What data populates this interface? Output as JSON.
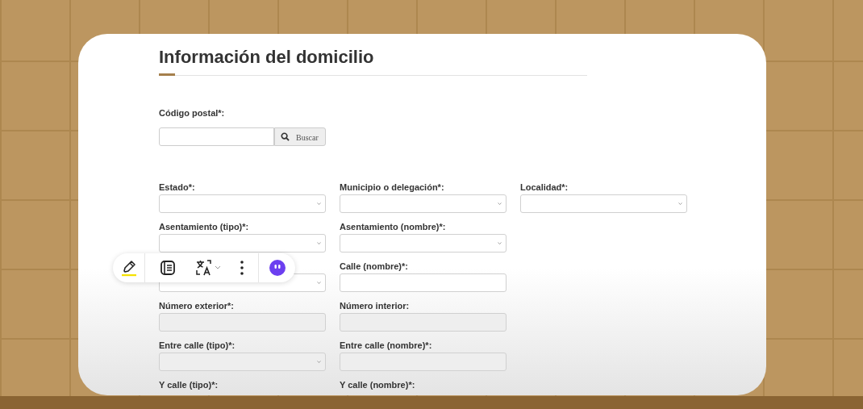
{
  "section_title": "Información del domicilio",
  "postal_code": {
    "label": "Código postal*:",
    "button": "Buscar"
  },
  "rows": [
    {
      "fields": [
        {
          "label": "Estado*:",
          "kind": "select",
          "disabled": false
        },
        {
          "label": "Municipio o delegación*:",
          "kind": "select",
          "disabled": false
        },
        {
          "label": "Localidad*:",
          "kind": "select",
          "disabled": false
        }
      ]
    },
    {
      "fields": [
        {
          "label": "Asentamiento (tipo)*:",
          "kind": "select",
          "disabled": false
        },
        {
          "label": "Asentamiento (nombre)*:",
          "kind": "select",
          "disabled": false
        }
      ]
    },
    {
      "fields": [
        {
          "kind": "select",
          "disabled": false
        },
        {
          "label": "Calle (nombre)*:",
          "kind": "input",
          "disabled": false
        }
      ]
    },
    {
      "fields": [
        {
          "label": "Número exterior*:",
          "kind": "input",
          "disabled": true
        },
        {
          "label": "Número interior:",
          "kind": "input",
          "disabled": true
        }
      ]
    },
    {
      "fields": [
        {
          "label": "Entre calle (tipo)*:",
          "kind": "select",
          "disabled": true
        },
        {
          "label": "Entre calle (nombre)*:",
          "kind": "input",
          "disabled": true
        }
      ]
    },
    {
      "fields": [
        {
          "label": "Y calle (tipo)*:"
        },
        {
          "label": "Y calle (nombre)*:"
        }
      ]
    }
  ]
}
